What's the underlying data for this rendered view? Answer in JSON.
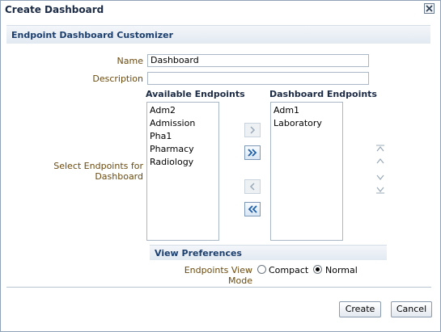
{
  "dialog": {
    "title": "Create Dashboard",
    "close_icon": "close-icon"
  },
  "section": {
    "title": "Endpoint Dashboard Customizer"
  },
  "form": {
    "name_label": "Name",
    "name_value": "Dashboard",
    "description_label": "Description",
    "description_value": "",
    "select_label": "Select Endpoints for Dashboard"
  },
  "available": {
    "header": "Available Endpoints",
    "items": [
      "Adm2",
      "Admission",
      "Pha1",
      "Pharmacy",
      "Radiology"
    ]
  },
  "dashboard": {
    "header": "Dashboard Endpoints",
    "items": [
      "Adm1",
      "Laboratory"
    ]
  },
  "shuttle_icons": {
    "move": "move-right-icon",
    "move_all": "move-all-right-icon",
    "remove": "move-left-icon",
    "remove_all": "move-all-left-icon"
  },
  "reorder_icons": {
    "top": "move-top-icon",
    "up": "move-up-icon",
    "down": "move-down-icon",
    "bottom": "move-bottom-icon"
  },
  "view_preferences": {
    "title": "View Preferences",
    "mode_label": "Endpoints View Mode",
    "options": [
      {
        "label": "Compact",
        "selected": false
      },
      {
        "label": "Normal",
        "selected": true
      }
    ]
  },
  "buttons": {
    "create": "Create",
    "cancel": "Cancel"
  },
  "colors": {
    "label_text": "#6b4a0e",
    "header_text": "#1c3f6e",
    "border": "#a9b7c6"
  }
}
